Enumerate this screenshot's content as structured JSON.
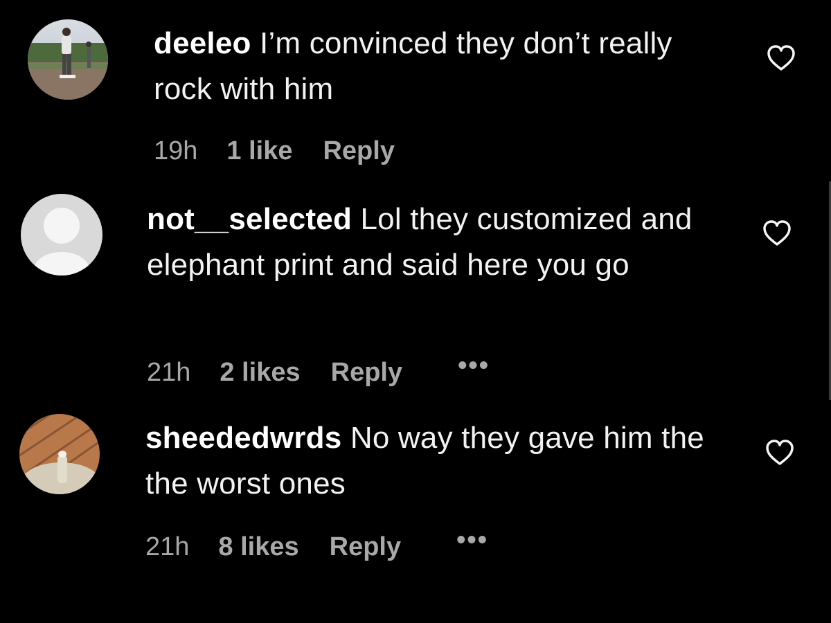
{
  "comments": [
    {
      "username": "deeleo",
      "text": "I’m convinced they don’t really rock with him",
      "time": "19h",
      "likes": "1 like",
      "reply": "Reply",
      "more": ""
    },
    {
      "username": "not__selected",
      "text": "Lol they customized and elephant print and said here you go",
      "time": "21h",
      "likes": "2 likes",
      "reply": "Reply",
      "more": "•••"
    },
    {
      "username": "sheededwrds",
      "text": "No way they gave him the the worst ones",
      "time": "21h",
      "likes": "8 likes",
      "reply": "Reply",
      "more": "•••"
    }
  ],
  "icons": {
    "like": "heart-outline-icon",
    "more": "more-options-icon"
  },
  "colors": {
    "background": "#000000",
    "text": "#f5f5f5",
    "meta": "#a8a8a8"
  }
}
